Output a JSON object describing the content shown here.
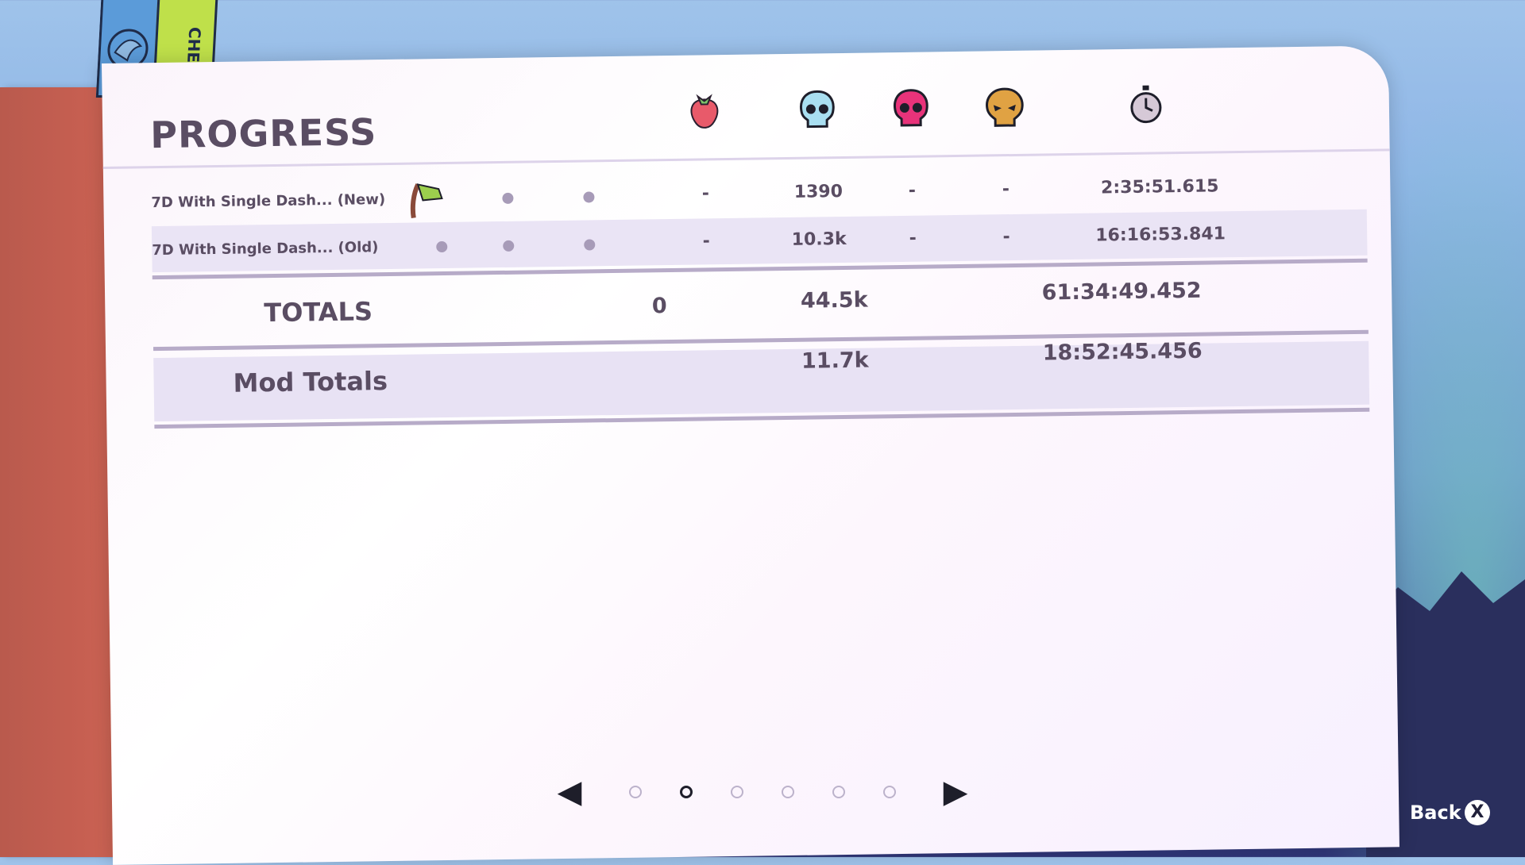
{
  "page": {
    "title": "PROGRESS",
    "bookmark_label": "CHEAT MODE",
    "columns": [
      {
        "icon": "strawberry-icon"
      },
      {
        "icon": "blue-skull-icon"
      },
      {
        "icon": "pink-skull-icon"
      },
      {
        "icon": "gold-skull-icon"
      },
      {
        "icon": "stopwatch-icon"
      }
    ],
    "rows": [
      {
        "label": "7D With Single Dash... (New)",
        "strawberries": "-",
        "deaths_a": "1390",
        "deaths_b": "-",
        "deaths_c": "-",
        "time": "2:35:51.615"
      },
      {
        "label": "7D With Single Dash... (Old)",
        "strawberries": "-",
        "deaths_a": "10.3k",
        "deaths_b": "-",
        "deaths_c": "-",
        "time": "16:16:53.841"
      }
    ],
    "totals": {
      "label": "TOTALS",
      "strawberries": "0",
      "deaths": "44.5k",
      "time": "61:34:49.452"
    },
    "mod_totals": {
      "label": "Mod Totals",
      "deaths": "11.7k",
      "time": "18:52:45.456"
    }
  },
  "pager": {
    "active_index": 1
  },
  "footer": {
    "back_label": "Back",
    "back_key": "X"
  },
  "colors": {
    "strawberry": "#e85a6a",
    "blue_skull": "#a9dff1",
    "pink_skull": "#e8337a",
    "gold_skull": "#e0a243"
  }
}
